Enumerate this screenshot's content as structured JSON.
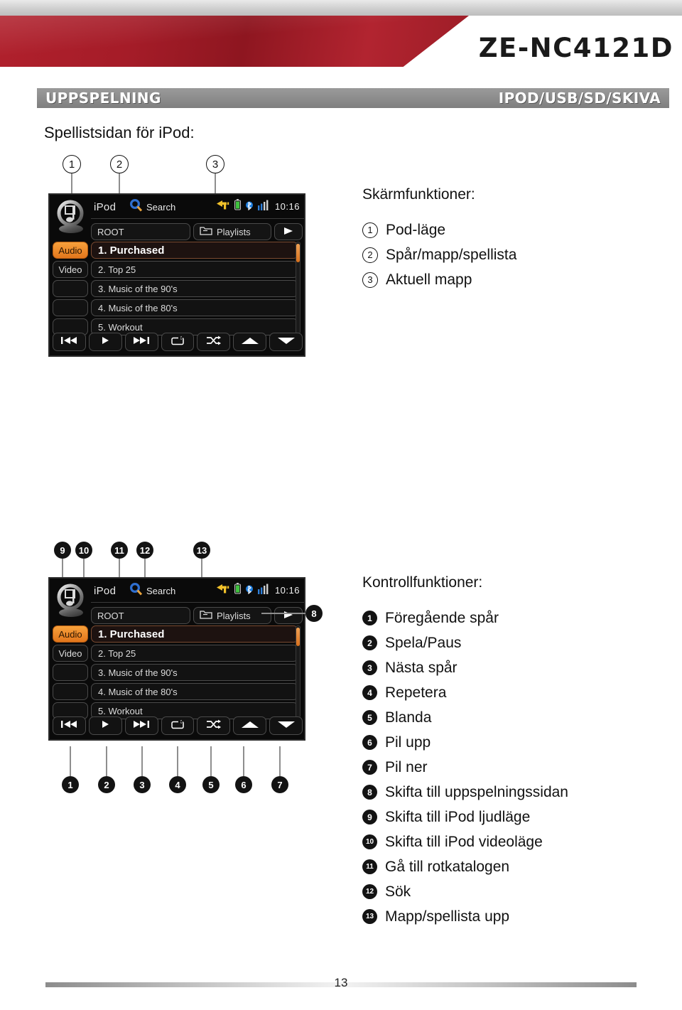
{
  "header": {
    "model": "ZE-NC4121D",
    "section_left": "UPPSPELNING",
    "section_right": "IPOD/USB/SD/SKIVA",
    "accent_red": "#a51c28",
    "bar_gray": "#8d8d8d"
  },
  "sub_heading": "Spellistsidan för iPod:",
  "device_screen": {
    "mode_label": "iPod",
    "search_label": "Search",
    "time": "10:16",
    "breadcrumb": "ROOT",
    "folder_button": "Playlists",
    "sidebar": [
      {
        "label": "Audio",
        "active": true
      },
      {
        "label": "Video",
        "active": false
      },
      {
        "label": "",
        "active": false
      },
      {
        "label": "",
        "active": false
      },
      {
        "label": "",
        "active": false
      }
    ],
    "list_items": [
      {
        "label": "1. Purchased",
        "selected": true
      },
      {
        "label": "2. Top 25",
        "selected": false
      },
      {
        "label": "3. Music of the 90's",
        "selected": false
      },
      {
        "label": "4. Music of the 80's",
        "selected": false
      },
      {
        "label": "5. Workout",
        "selected": false
      }
    ],
    "controls": [
      "previous-track-icon",
      "play-icon",
      "next-track-icon",
      "repeat-icon",
      "shuffle-icon",
      "arrow-up-icon",
      "arrow-down-icon"
    ],
    "status_icons": [
      "navigation-arrow-icon",
      "battery-icon",
      "bluetooth-icon",
      "signal-bars-icon"
    ],
    "accent_orange": "#e2761c"
  },
  "screen_functions": {
    "title": "Skärmfunktioner:",
    "items": [
      {
        "num": "1",
        "label": "Pod-läge"
      },
      {
        "num": "2",
        "label": "Spår/mapp/spellista"
      },
      {
        "num": "3",
        "label": "Aktuell mapp"
      }
    ]
  },
  "control_functions": {
    "title": "Kontrollfunktioner:",
    "items": [
      {
        "num": "1",
        "label": "Föregående spår"
      },
      {
        "num": "2",
        "label": "Spela/Paus"
      },
      {
        "num": "3",
        "label": "Nästa spår"
      },
      {
        "num": "4",
        "label": "Repetera"
      },
      {
        "num": "5",
        "label": "Blanda"
      },
      {
        "num": "6",
        "label": "Pil upp"
      },
      {
        "num": "7",
        "label": "Pil ner"
      },
      {
        "num": "8",
        "label": "Skifta till uppspelningssidan"
      },
      {
        "num": "9",
        "label": "Skifta till iPod ljudläge"
      },
      {
        "num": "10",
        "label": "Skifta till iPod videoläge"
      },
      {
        "num": "11",
        "label": "Gå till rotkatalogen"
      },
      {
        "num": "12",
        "label": "Sök"
      },
      {
        "num": "13",
        "label": "Mapp/spellista upp"
      }
    ]
  },
  "figure_top_callouts": [
    {
      "num": "1"
    },
    {
      "num": "2"
    },
    {
      "num": "3"
    }
  ],
  "figure_bottom_callouts_top": [
    {
      "num": "9"
    },
    {
      "num": "10"
    },
    {
      "num": "11"
    },
    {
      "num": "12"
    },
    {
      "num": "13"
    }
  ],
  "figure_bottom_callouts_bottom": [
    {
      "num": "1"
    },
    {
      "num": "2"
    },
    {
      "num": "3"
    },
    {
      "num": "4"
    },
    {
      "num": "5"
    },
    {
      "num": "6"
    },
    {
      "num": "7"
    }
  ],
  "figure_bottom_callout_right": {
    "num": "8"
  },
  "footer": {
    "page": "13"
  }
}
